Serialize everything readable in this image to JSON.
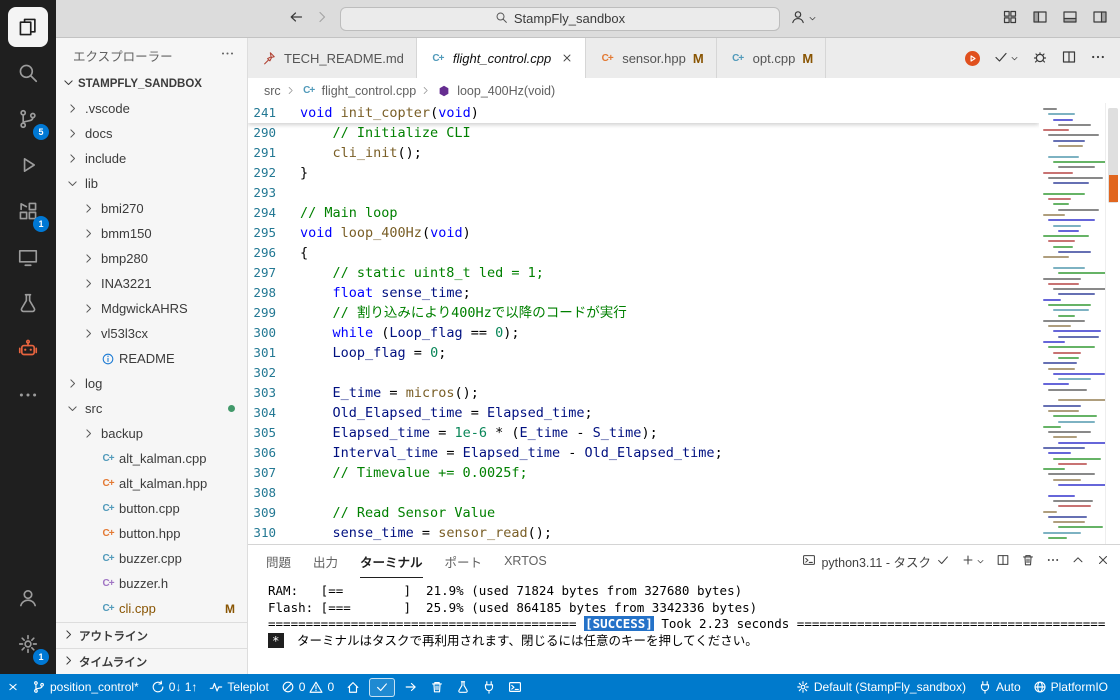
{
  "titlebar": {
    "search": "StampFly_sandbox"
  },
  "activitybar": {
    "badges": {
      "source_control": "5",
      "extensions": "1",
      "settings": "1"
    }
  },
  "sidebar": {
    "title": "エクスプローラー",
    "workspace": "STAMPFLY_SANDBOX",
    "tree": [
      {
        "label": ".vscode",
        "kind": "folder",
        "depth": 0
      },
      {
        "label": "docs",
        "kind": "folder",
        "depth": 0
      },
      {
        "label": "include",
        "kind": "folder",
        "depth": 0
      },
      {
        "label": "lib",
        "kind": "folder",
        "depth": 0,
        "expanded": true
      },
      {
        "label": "bmi270",
        "kind": "folder",
        "depth": 1
      },
      {
        "label": "bmm150",
        "kind": "folder",
        "depth": 1
      },
      {
        "label": "bmp280",
        "kind": "folder",
        "depth": 1
      },
      {
        "label": "INA3221",
        "kind": "folder",
        "depth": 1
      },
      {
        "label": "MdgwickAHRS",
        "kind": "folder",
        "depth": 1
      },
      {
        "label": "vl53l3cx",
        "kind": "folder",
        "depth": 1
      },
      {
        "label": "README",
        "kind": "file",
        "icon": "info",
        "depth": 1
      },
      {
        "label": "log",
        "kind": "folder",
        "depth": 0
      },
      {
        "label": "src",
        "kind": "folder",
        "depth": 0,
        "expanded": true,
        "dot": true
      },
      {
        "label": "backup",
        "kind": "folder",
        "depth": 1
      },
      {
        "label": "alt_kalman.cpp",
        "kind": "file",
        "icon": "cpp",
        "depth": 1
      },
      {
        "label": "alt_kalman.hpp",
        "kind": "file",
        "icon": "hpp",
        "depth": 1
      },
      {
        "label": "button.cpp",
        "kind": "file",
        "icon": "cpp",
        "depth": 1
      },
      {
        "label": "button.hpp",
        "kind": "file",
        "icon": "hpp",
        "depth": 1
      },
      {
        "label": "buzzer.cpp",
        "kind": "file",
        "icon": "cpp",
        "depth": 1
      },
      {
        "label": "buzzer.h",
        "kind": "file",
        "icon": "h",
        "depth": 1
      },
      {
        "label": "cli.cpp",
        "kind": "file",
        "icon": "cpp",
        "depth": 1,
        "badge": "M",
        "git": true
      }
    ],
    "sections": [
      "アウトライン",
      "タイムライン"
    ]
  },
  "tabs": [
    {
      "label": "TECH_README.md",
      "icon": "pin",
      "active": false
    },
    {
      "label": "flight_control.cpp",
      "icon": "cpp",
      "active": true
    },
    {
      "label": "sensor.hpp",
      "icon": "hpp",
      "active": false,
      "modified": "M"
    },
    {
      "label": "opt.cpp",
      "icon": "cpp",
      "active": false,
      "modified": "M"
    }
  ],
  "breadcrumb": [
    {
      "label": "src"
    },
    {
      "label": "flight_control.cpp",
      "icon": "cpp"
    },
    {
      "label": "loop_400Hz(void)",
      "icon": "method"
    }
  ],
  "editor": {
    "sticky": {
      "num": "241",
      "tokens": [
        [
          "k",
          "void"
        ],
        [
          "p",
          " "
        ],
        [
          "fn",
          "init_copter"
        ],
        [
          "p",
          "("
        ],
        [
          "k",
          "void"
        ],
        [
          "p",
          ")"
        ]
      ]
    },
    "lines": [
      {
        "num": "290",
        "tokens": [
          [
            "p",
            "    "
          ],
          [
            "c",
            "// Initialize CLI"
          ]
        ]
      },
      {
        "num": "291",
        "tokens": [
          [
            "p",
            "    "
          ],
          [
            "fn",
            "cli_init"
          ],
          [
            "p",
            "();"
          ]
        ]
      },
      {
        "num": "292",
        "tokens": [
          [
            "p",
            "}"
          ]
        ]
      },
      {
        "num": "293",
        "tokens": []
      },
      {
        "num": "294",
        "tokens": [
          [
            "c",
            "// Main loop"
          ]
        ]
      },
      {
        "num": "295",
        "tokens": [
          [
            "k",
            "void"
          ],
          [
            "p",
            " "
          ],
          [
            "fn",
            "loop_400Hz"
          ],
          [
            "p",
            "("
          ],
          [
            "k",
            "void"
          ],
          [
            "p",
            ")"
          ]
        ]
      },
      {
        "num": "296",
        "tokens": [
          [
            "p",
            "{"
          ]
        ]
      },
      {
        "num": "297",
        "tokens": [
          [
            "p",
            "    "
          ],
          [
            "c",
            "// static uint8_t led = 1;"
          ]
        ]
      },
      {
        "num": "298",
        "tokens": [
          [
            "p",
            "    "
          ],
          [
            "k",
            "float"
          ],
          [
            "p",
            " "
          ],
          [
            "v",
            "sense_time"
          ],
          [
            "p",
            ";"
          ]
        ]
      },
      {
        "num": "299",
        "tokens": [
          [
            "p",
            "    "
          ],
          [
            "c",
            "// 割り込みにより400Hzで以降のコードが実行"
          ]
        ]
      },
      {
        "num": "300",
        "tokens": [
          [
            "p",
            "    "
          ],
          [
            "k",
            "while"
          ],
          [
            "p",
            " ("
          ],
          [
            "v",
            "Loop_flag"
          ],
          [
            "p",
            " == "
          ],
          [
            "n",
            "0"
          ],
          [
            "p",
            ");"
          ]
        ]
      },
      {
        "num": "301",
        "tokens": [
          [
            "p",
            "    "
          ],
          [
            "v",
            "Loop_flag"
          ],
          [
            "p",
            " = "
          ],
          [
            "n",
            "0"
          ],
          [
            "p",
            ";"
          ]
        ]
      },
      {
        "num": "302",
        "tokens": []
      },
      {
        "num": "303",
        "tokens": [
          [
            "p",
            "    "
          ],
          [
            "v",
            "E_time"
          ],
          [
            "p",
            " = "
          ],
          [
            "fn",
            "micros"
          ],
          [
            "p",
            "();"
          ]
        ]
      },
      {
        "num": "304",
        "tokens": [
          [
            "p",
            "    "
          ],
          [
            "v",
            "Old_Elapsed_time"
          ],
          [
            "p",
            " = "
          ],
          [
            "v",
            "Elapsed_time"
          ],
          [
            "p",
            ";"
          ]
        ]
      },
      {
        "num": "305",
        "tokens": [
          [
            "p",
            "    "
          ],
          [
            "v",
            "Elapsed_time"
          ],
          [
            "p",
            " = "
          ],
          [
            "n",
            "1e-6"
          ],
          [
            "p",
            " * ("
          ],
          [
            "v",
            "E_time"
          ],
          [
            "p",
            " - "
          ],
          [
            "v",
            "S_time"
          ],
          [
            "p",
            ");"
          ]
        ]
      },
      {
        "num": "306",
        "tokens": [
          [
            "p",
            "    "
          ],
          [
            "v",
            "Interval_time"
          ],
          [
            "p",
            " = "
          ],
          [
            "v",
            "Elapsed_time"
          ],
          [
            "p",
            " - "
          ],
          [
            "v",
            "Old_Elapsed_time"
          ],
          [
            "p",
            ";"
          ]
        ]
      },
      {
        "num": "307",
        "tokens": [
          [
            "p",
            "    "
          ],
          [
            "c",
            "// Timevalue += 0.0025f;"
          ]
        ]
      },
      {
        "num": "308",
        "tokens": []
      },
      {
        "num": "309",
        "tokens": [
          [
            "p",
            "    "
          ],
          [
            "c",
            "// Read Sensor Value"
          ]
        ]
      },
      {
        "num": "310",
        "tokens": [
          [
            "p",
            "    "
          ],
          [
            "v",
            "sense_time"
          ],
          [
            "p",
            " = "
          ],
          [
            "fn",
            "sensor_read"
          ],
          [
            "p",
            "();"
          ]
        ]
      }
    ]
  },
  "terminal": {
    "tabs": [
      "問題",
      "出力",
      "ターミナル",
      "ポート",
      "XRTOS"
    ],
    "active_tab": "ターミナル",
    "task_label": "python3.11 - タスク",
    "lines": [
      [
        [
          "p",
          "RAM:   [==        ]  21.9% (used 71824 bytes from 327680 bytes)"
        ]
      ],
      [
        [
          "p",
          "Flash: [===       ]  25.9% (used 864185 bytes from 3342336 bytes)"
        ]
      ],
      [
        [
          "p",
          "========================================= "
        ],
        [
          "succ",
          "[SUCCESS]"
        ],
        [
          "p",
          " Took 2.23 seconds ========================================="
        ]
      ],
      [
        [
          "inv",
          "*"
        ],
        [
          "p",
          " ターミナルはタスクで再利用されます、閉じるには任意のキーを押してください。"
        ]
      ]
    ]
  },
  "statusbar": {
    "left": [
      {
        "name": "remote",
        "icon": "remote"
      },
      {
        "name": "git-branch",
        "icon": "branch",
        "label": "position_control*"
      },
      {
        "name": "sync-changes",
        "icon": "sync",
        "label": "0↓ 1↑"
      },
      {
        "name": "teleplot",
        "icon": "pulse",
        "label": "Teleplot"
      },
      {
        "name": "problems",
        "parts": [
          [
            "error",
            "0"
          ],
          [
            "warning",
            "0"
          ]
        ]
      },
      {
        "name": "pio-home",
        "icon": "home"
      },
      {
        "name": "pio-build",
        "icon": "check",
        "boxed": true
      },
      {
        "name": "pio-upload",
        "icon": "arrow-right"
      },
      {
        "name": "pio-clean",
        "icon": "trash"
      },
      {
        "name": "pio-test",
        "icon": "beaker"
      },
      {
        "name": "pio-serial-monitor",
        "icon": "plug"
      },
      {
        "name": "pio-terminal",
        "icon": "terminal"
      }
    ],
    "right": [
      {
        "name": "pio-env",
        "icon": "gear",
        "label": "Default (StampFly_sandbox)"
      },
      {
        "name": "serial-port",
        "icon": "plug",
        "label": "Auto"
      },
      {
        "name": "platformio",
        "icon": "globe",
        "label": "PlatformIO"
      }
    ]
  },
  "colors": {
    "statusbar": "#007acc",
    "accent": "#0078d4",
    "git_modified": "#895503",
    "cpp_icon": "#519aba",
    "hpp_icon": "#e37933",
    "h_icon": "#a074c4",
    "success": "#2472c8"
  }
}
